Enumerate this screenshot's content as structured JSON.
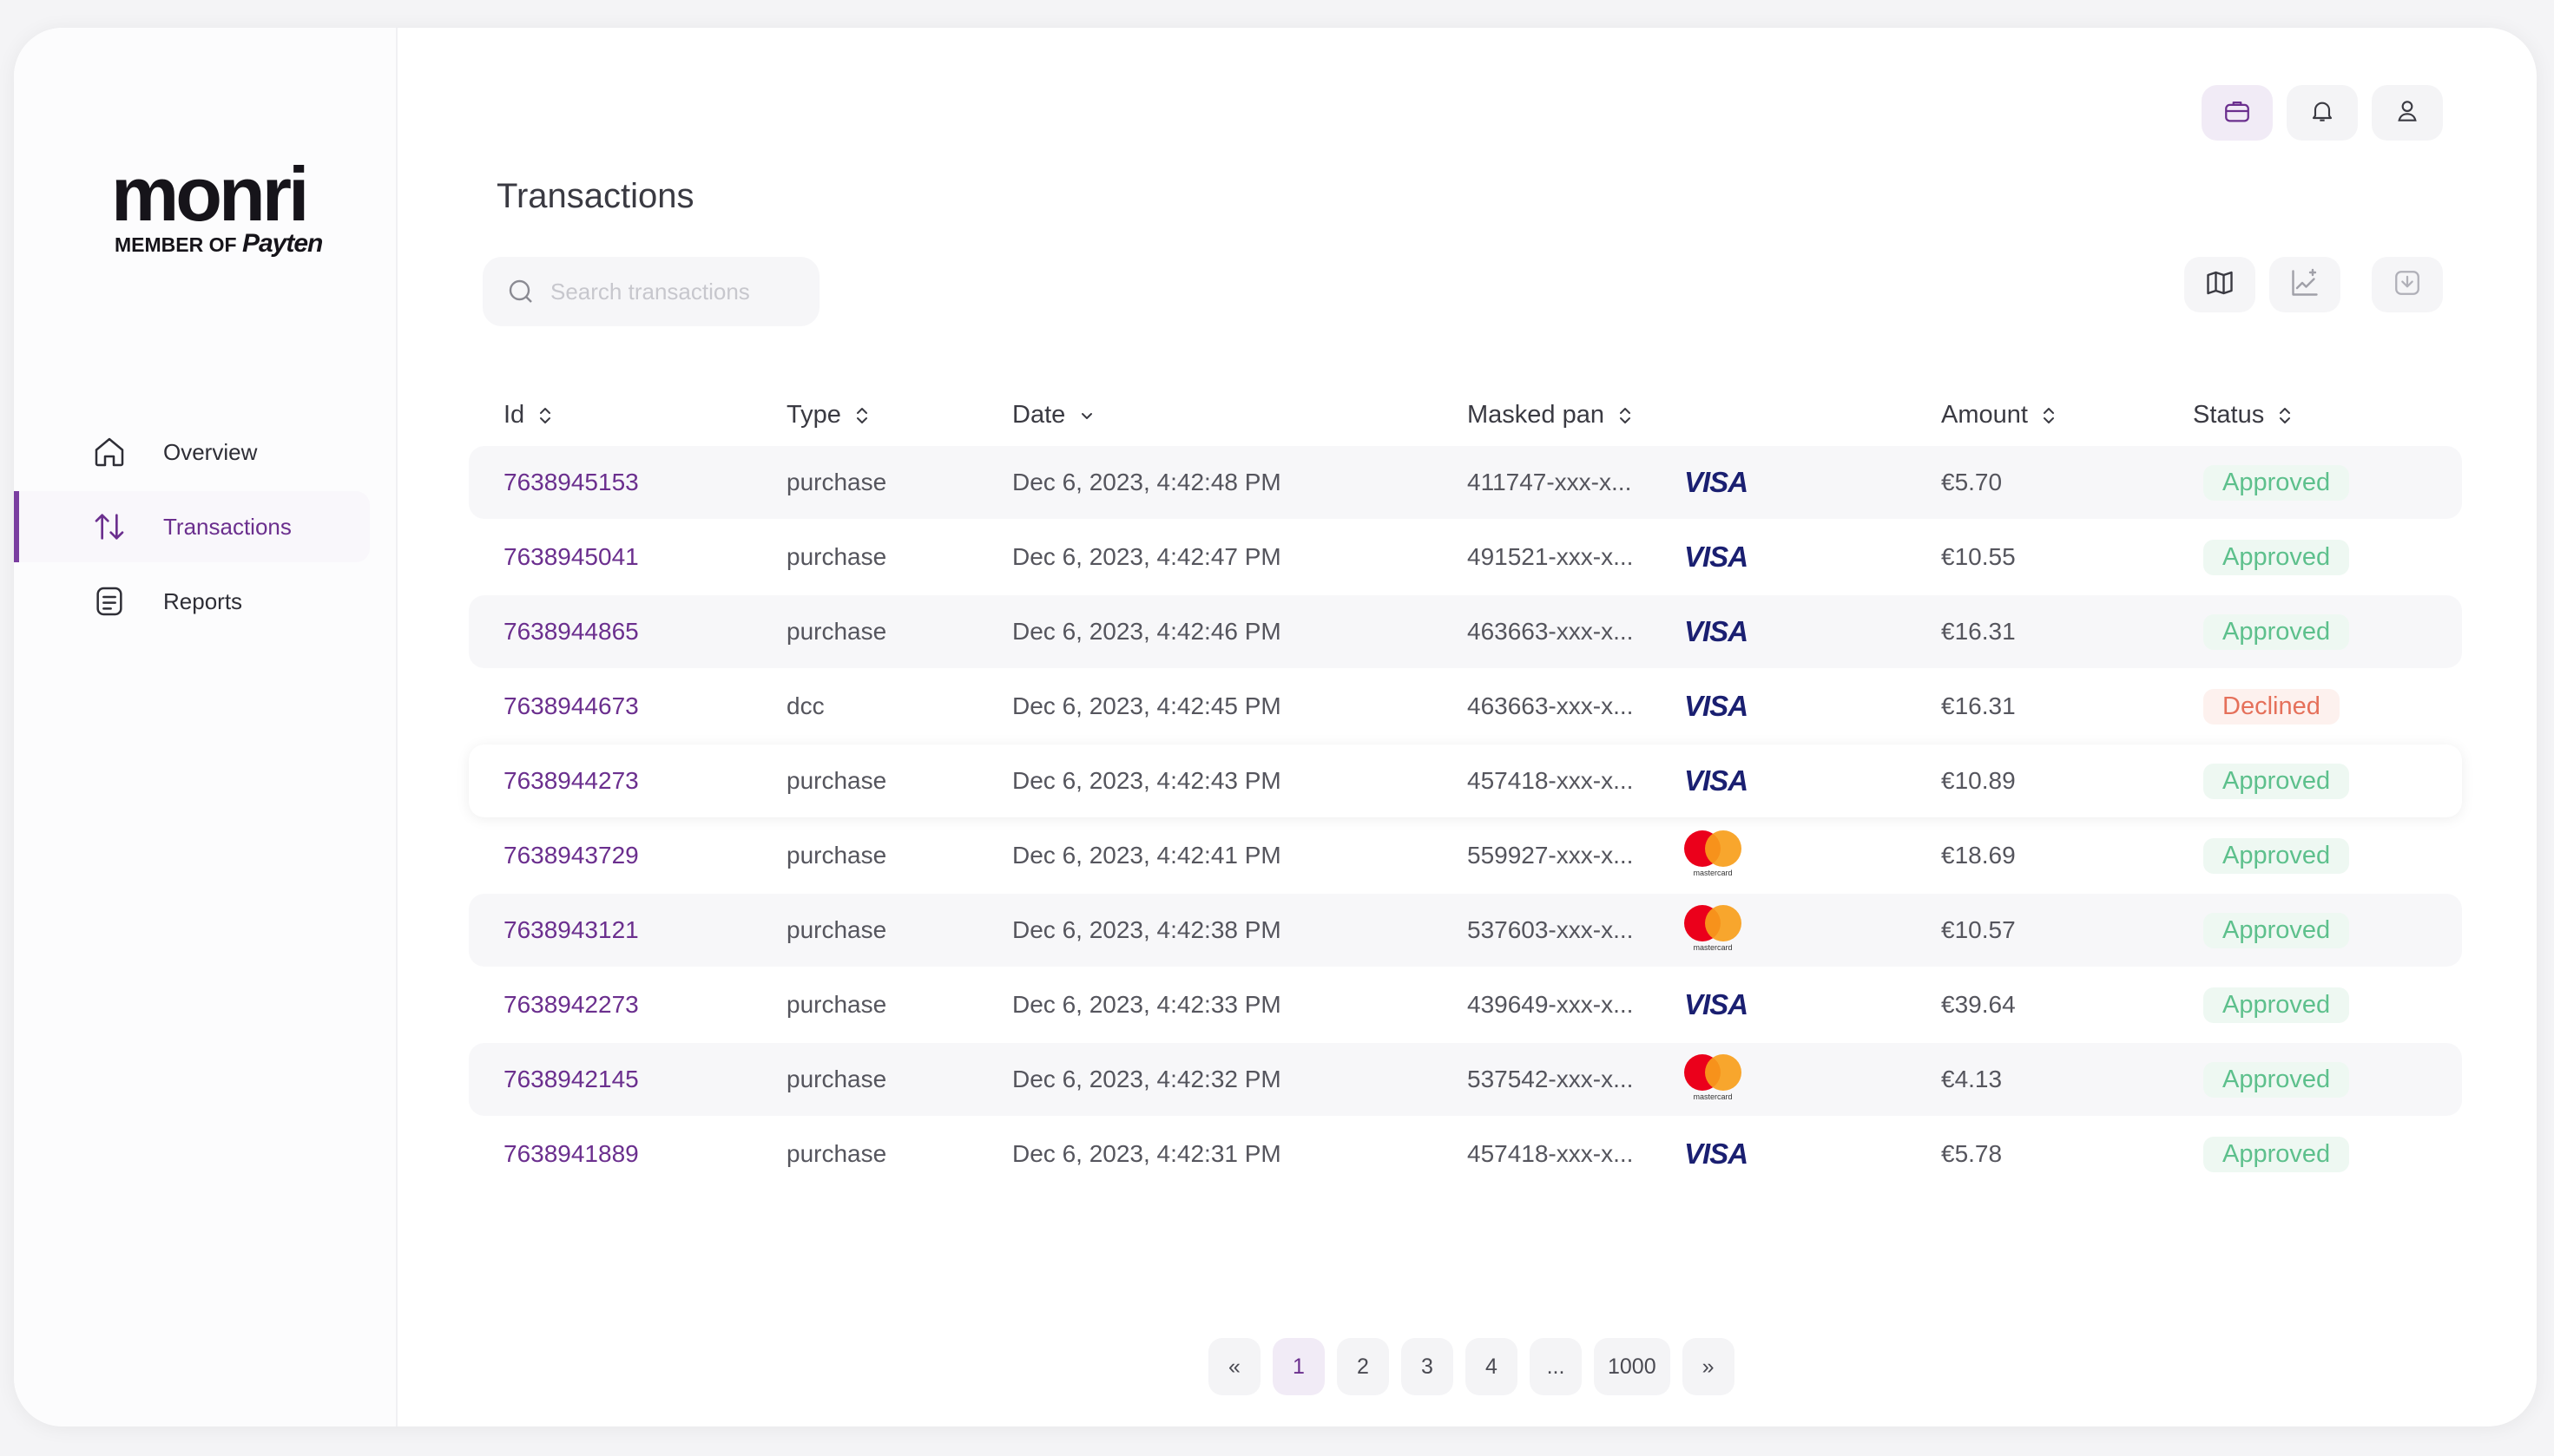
{
  "app": {
    "logo_word": "monri",
    "logo_sub": "MEMBER OF",
    "logo_brand": "Payten"
  },
  "sidebar": {
    "items": [
      {
        "label": "Overview",
        "icon": "home-icon",
        "active": false
      },
      {
        "label": "Transactions",
        "icon": "arrows-up-down-icon",
        "active": true
      },
      {
        "label": "Reports",
        "icon": "document-icon",
        "active": false
      }
    ]
  },
  "header": {
    "title": "Transactions",
    "buttons": [
      "briefcase-icon",
      "bell-icon",
      "user-icon"
    ]
  },
  "search": {
    "placeholder": "Search transactions",
    "value": ""
  },
  "toolbar": {
    "buttons": [
      "map-icon",
      "chart-icon",
      "download-icon"
    ]
  },
  "table": {
    "columns": [
      "Id",
      "Type",
      "Date",
      "Masked pan",
      "Amount",
      "Status"
    ],
    "rows": [
      {
        "id": "7638945153",
        "type": "purchase",
        "date": "Dec 6, 2023, 4:42:48 PM",
        "pan": "411747-xxx-x...",
        "brand": "visa",
        "amount": "€5.70",
        "status": "Approved"
      },
      {
        "id": "7638945041",
        "type": "purchase",
        "date": "Dec 6, 2023, 4:42:47 PM",
        "pan": "491521-xxx-x...",
        "brand": "visa",
        "amount": "€10.55",
        "status": "Approved"
      },
      {
        "id": "7638944865",
        "type": "purchase",
        "date": "Dec 6, 2023, 4:42:46 PM",
        "pan": "463663-xxx-x...",
        "brand": "visa",
        "amount": "€16.31",
        "status": "Approved"
      },
      {
        "id": "7638944673",
        "type": "dcc",
        "date": "Dec 6, 2023, 4:42:45 PM",
        "pan": "463663-xxx-x...",
        "brand": "visa",
        "amount": "€16.31",
        "status": "Declined"
      },
      {
        "id": "7638944273",
        "type": "purchase",
        "date": "Dec 6, 2023, 4:42:43 PM",
        "pan": "457418-xxx-x...",
        "brand": "visa",
        "amount": "€10.89",
        "status": "Approved"
      },
      {
        "id": "7638943729",
        "type": "purchase",
        "date": "Dec 6, 2023, 4:42:41 PM",
        "pan": "559927-xxx-x...",
        "brand": "mastercard",
        "amount": "€18.69",
        "status": "Approved"
      },
      {
        "id": "7638943121",
        "type": "purchase",
        "date": "Dec 6, 2023, 4:42:38 PM",
        "pan": "537603-xxx-x...",
        "brand": "mastercard",
        "amount": "€10.57",
        "status": "Approved"
      },
      {
        "id": "7638942273",
        "type": "purchase",
        "date": "Dec 6, 2023, 4:42:33 PM",
        "pan": "439649-xxx-x...",
        "brand": "visa",
        "amount": "€39.64",
        "status": "Approved"
      },
      {
        "id": "7638942145",
        "type": "purchase",
        "date": "Dec 6, 2023, 4:42:32 PM",
        "pan": "537542-xxx-x...",
        "brand": "mastercard",
        "amount": "€4.13",
        "status": "Approved"
      },
      {
        "id": "7638941889",
        "type": "purchase",
        "date": "Dec 6, 2023, 4:42:31 PM",
        "pan": "457418-xxx-x...",
        "brand": "visa",
        "amount": "€5.78",
        "status": "Approved"
      }
    ]
  },
  "brands": {
    "visa": "VISA",
    "mastercard": "mastercard"
  },
  "pagination": {
    "prev": "«",
    "next": "»",
    "pages": [
      "1",
      "2",
      "3",
      "4",
      "...",
      "1000"
    ],
    "current": "1"
  },
  "colors": {
    "accent": "#6b2f8e",
    "approved": "#5dc08c",
    "declined": "#e5705a"
  }
}
